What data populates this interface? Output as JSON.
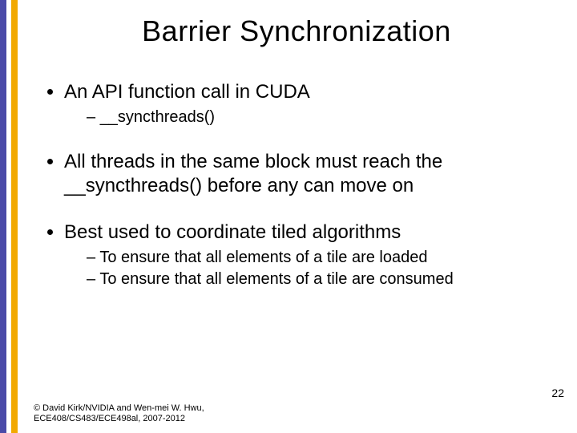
{
  "title": "Barrier Synchronization",
  "bullets": {
    "b1": {
      "text": "An API function call in CUDA",
      "sub": {
        "s1": "__syncthreads()"
      }
    },
    "b2": {
      "text": "All threads in the same block must reach the __syncthreads() before any can move on"
    },
    "b3": {
      "text": "Best used to coordinate tiled algorithms",
      "sub": {
        "s1": "To ensure that all elements of a tile are loaded",
        "s2": "To ensure that all elements of a tile are consumed"
      }
    }
  },
  "footer": {
    "line1": "© David Kirk/NVIDIA and Wen-mei W. Hwu,",
    "line2": "ECE408/CS483/ECE498al, 2007-2012"
  },
  "page_number": "22"
}
